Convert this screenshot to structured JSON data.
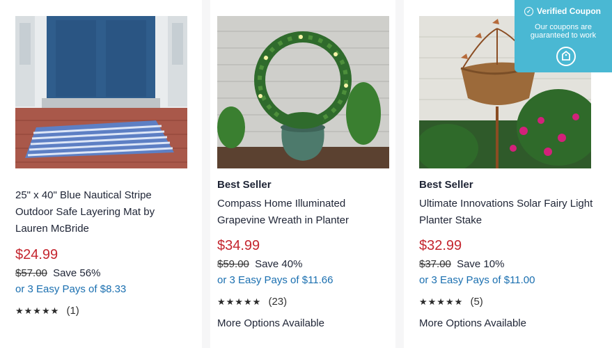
{
  "products": [
    {
      "badge": "",
      "title": "25\" x 40\" Blue Nautical Stripe Outdoor Safe Layering Mat by Lauren McBride",
      "price": "$24.99",
      "old_price": "$57.00",
      "save": "Save 56%",
      "easy_pay": "or 3 Easy Pays of $8.33",
      "stars": "★★★★★",
      "review_count": "(1)",
      "more_options": ""
    },
    {
      "badge": "Best Seller",
      "title": "Compass Home Illuminated Grapevine Wreath in Planter",
      "price": "$34.99",
      "old_price": "$59.00",
      "save": "Save 40%",
      "easy_pay": "or 3 Easy Pays of $11.66",
      "stars": "★★★★★",
      "review_count": "(23)",
      "more_options": "More Options Available"
    },
    {
      "badge": "Best Seller",
      "title": "Ultimate Innovations Solar Fairy Light Planter Stake",
      "price": "$32.99",
      "old_price": "$37.00",
      "save": "Save 10%",
      "easy_pay": "or 3 Easy Pays of $11.00",
      "stars": "★★★★★",
      "review_count": "(5)",
      "more_options": "More Options Available"
    }
  ],
  "coupon": {
    "title": "Verified Coupon",
    "subtitle": "Our coupons are guaranteed to work",
    "icon": "coupon-tag-icon"
  },
  "colors": {
    "price_red": "#c4252e",
    "link_blue": "#1a6fb0",
    "coupon_bg": "#4ab8d3"
  }
}
